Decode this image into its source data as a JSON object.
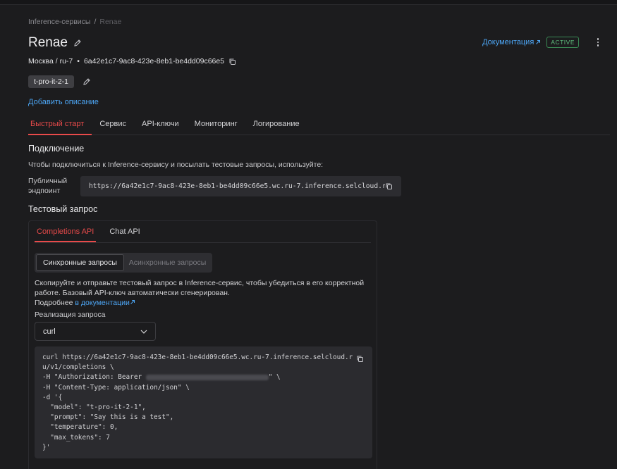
{
  "breadcrumb": {
    "parent": "Inference-сервисы",
    "separator": "/",
    "current": "Renae"
  },
  "header": {
    "title": "Renae",
    "docs_label": "Документация",
    "status": "ACTIVE"
  },
  "meta": {
    "location": "Москва / ru-7",
    "bullet": "•",
    "id": "6a42e1c7-9ac8-423e-8eb1-be4dd09c66e5"
  },
  "tag": {
    "label": "t-pro-it-2-1"
  },
  "add_description": "Добавить описание",
  "tabs": [
    {
      "label": "Быстрый старт",
      "active": true
    },
    {
      "label": "Сервис"
    },
    {
      "label": "API-ключи"
    },
    {
      "label": "Мониторинг"
    },
    {
      "label": "Логирование"
    }
  ],
  "connection": {
    "title": "Подключение",
    "text": "Чтобы подключиться к Inference-сервису и посылать тестовые запросы, используйте:",
    "endpoint_label_1": "Публичный",
    "endpoint_label_2": "эндпоинт",
    "endpoint_url": "https://6a42e1c7-9ac8-423e-8eb1-be4dd09c66e5.wc.ru-7.inference.selcloud.ru"
  },
  "test_request": {
    "title": "Тестовый запрос",
    "api_tabs": [
      {
        "label": "Completions API",
        "active": true
      },
      {
        "label": "Chat API"
      }
    ],
    "mode": {
      "sync": "Синхронные запросы",
      "async": "Асинхронные запросы"
    },
    "desc_1": "Скопируйте и отправьте тестовый запрос в Inference-сервис, чтобы убедиться в его корректной",
    "desc_2": "работе. Базовый API-ключ автоматически сгенерирован.",
    "more_prefix": "Подробнее",
    "more_link": "в документации",
    "impl_label": "Реализация запроса",
    "impl_value": "curl",
    "code": [
      "curl https://6a42e1c7-9ac8-423e-8eb1-be4dd09c66e5.wc.ru-7.inference.selcloud.r",
      "u/v1/completions \\",
      "-H \"Authorization: Bearer ",
      "\" \\",
      "-H \"Content-Type: application/json\" \\",
      "-d '{",
      "  \"model\": \"t-pro-it-2-1\",",
      "  \"prompt\": \"Say this is a test\",",
      "  \"temperature\": 0,",
      "  \"max_tokens\": 7",
      "}'"
    ]
  },
  "colors": {
    "accent": "#e84a4a",
    "link": "#4da6f5",
    "status": "#5fbf7f",
    "bg": "#1c1c1e"
  },
  "icons": {
    "edit": "pencil-icon",
    "copy": "copy-icon",
    "external": "external-link-icon",
    "menu": "kebab-menu-icon",
    "dropdown": "chevron-down-icon"
  }
}
